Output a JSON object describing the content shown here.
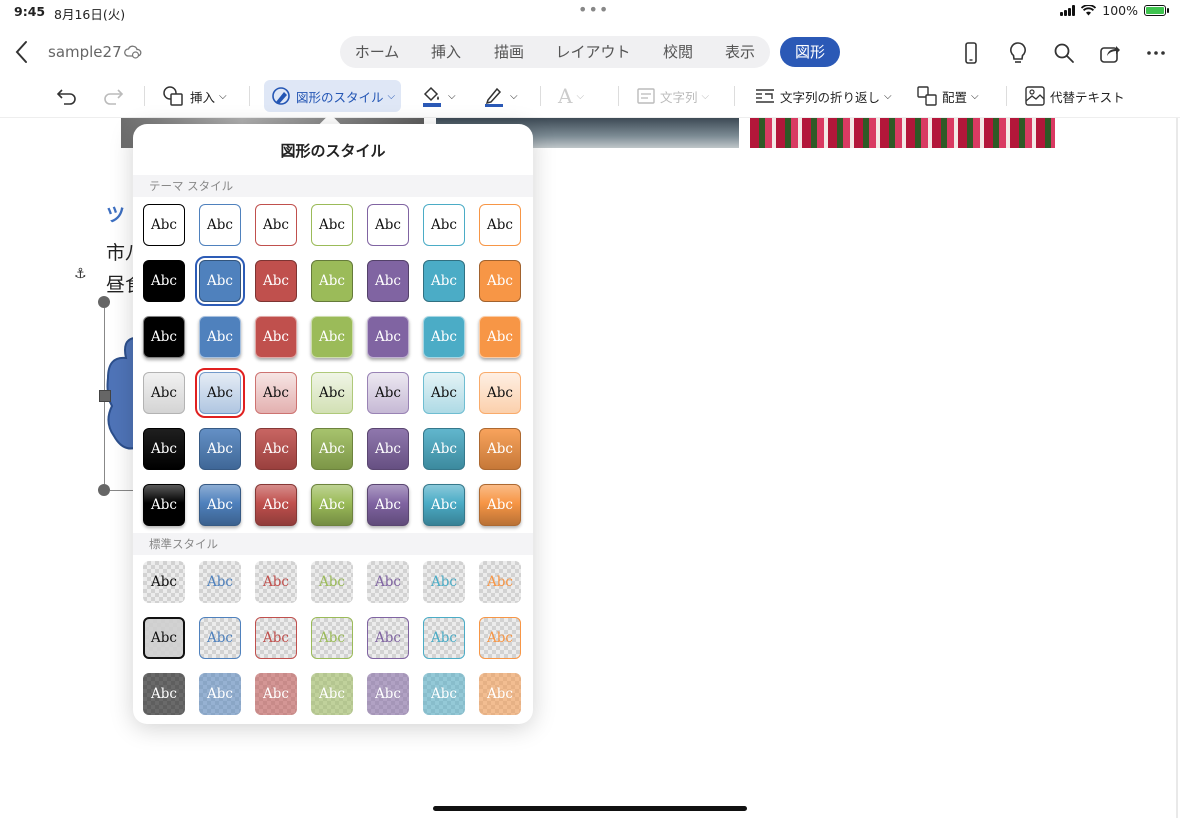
{
  "status_bar": {
    "time": "9:45",
    "date": "8月16日(火)",
    "battery": "100%"
  },
  "header": {
    "doc_title": "sample27",
    "tabs": [
      {
        "label": "ホーム"
      },
      {
        "label": "挿入"
      },
      {
        "label": "描画"
      },
      {
        "label": "レイアウト"
      },
      {
        "label": "校閲"
      },
      {
        "label": "表示"
      }
    ],
    "active_tab": "図形"
  },
  "ribbon": {
    "insert": "挿入",
    "shape_style": "図形のスタイル",
    "text_direction": "文字列",
    "text_wrap": "文字列の折り返し",
    "arrange": "配置",
    "alt_text": "代替テキスト",
    "text_glyph": "A"
  },
  "document": {
    "heading": "ツ",
    "line1": "市八",
    "line2": "昼食"
  },
  "popover": {
    "title": "図形のスタイル",
    "section_theme": "テーマ スタイル",
    "section_standard": "標準スタイル",
    "sample_text": "Abc",
    "accent_colors": [
      "#000000",
      "#4f81bd",
      "#c0504d",
      "#9bbb59",
      "#8064a2",
      "#4bacc6",
      "#f79646"
    ]
  },
  "theme_rows": [
    [
      {
        "t": "Abc"
      },
      {
        "t": "Abc"
      },
      {
        "t": "Abc"
      },
      {
        "t": "Abc"
      },
      {
        "t": "Abc"
      },
      {
        "t": "Abc"
      },
      {
        "t": "Abc"
      }
    ],
    [
      {
        "t": "Abc"
      },
      {
        "t": "Abc"
      },
      {
        "t": "Abc"
      },
      {
        "t": "Abc"
      },
      {
        "t": "Abc"
      },
      {
        "t": "Abc"
      },
      {
        "t": "Abc"
      }
    ],
    [
      {
        "t": "Abc"
      },
      {
        "t": "Abc"
      },
      {
        "t": "Abc"
      },
      {
        "t": "Abc"
      },
      {
        "t": "Abc"
      },
      {
        "t": "Abc"
      },
      {
        "t": "Abc"
      }
    ],
    [
      {
        "t": "Abc"
      },
      {
        "t": "Abc"
      },
      {
        "t": "Abc"
      },
      {
        "t": "Abc"
      },
      {
        "t": "Abc"
      },
      {
        "t": "Abc"
      },
      {
        "t": "Abc"
      }
    ],
    [
      {
        "t": "Abc"
      },
      {
        "t": "Abc"
      },
      {
        "t": "Abc"
      },
      {
        "t": "Abc"
      },
      {
        "t": "Abc"
      },
      {
        "t": "Abc"
      },
      {
        "t": "Abc"
      }
    ],
    [
      {
        "t": "Abc"
      },
      {
        "t": "Abc"
      },
      {
        "t": "Abc"
      },
      {
        "t": "Abc"
      },
      {
        "t": "Abc"
      },
      {
        "t": "Abc"
      },
      {
        "t": "Abc"
      }
    ]
  ],
  "standard_rows": [
    [
      {
        "t": "Abc"
      },
      {
        "t": "Abc"
      },
      {
        "t": "Abc"
      },
      {
        "t": "Abc"
      },
      {
        "t": "Abc"
      },
      {
        "t": "Abc"
      },
      {
        "t": "Abc"
      }
    ],
    [
      {
        "t": "Abc"
      },
      {
        "t": "Abc"
      },
      {
        "t": "Abc"
      },
      {
        "t": "Abc"
      },
      {
        "t": "Abc"
      },
      {
        "t": "Abc"
      },
      {
        "t": "Abc"
      }
    ],
    [
      {
        "t": "Abc"
      },
      {
        "t": "Abc"
      },
      {
        "t": "Abc"
      },
      {
        "t": "Abc"
      },
      {
        "t": "Abc"
      },
      {
        "t": "Abc"
      },
      {
        "t": "Abc"
      }
    ]
  ]
}
